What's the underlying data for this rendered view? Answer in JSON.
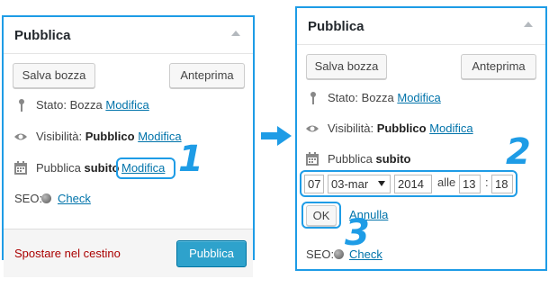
{
  "left_panel": {
    "title": "Pubblica",
    "save_draft": "Salva bozza",
    "preview": "Anteprima",
    "status_label": "Stato:",
    "status_value": "Bozza",
    "status_edit": "Modifica",
    "visibility_label": "Visibilità:",
    "visibility_value": "Pubblico",
    "visibility_edit": "Modifica",
    "publish_label": "Pubblica",
    "publish_value": "subito",
    "publish_edit": "Modifica",
    "seo_label": "SEO:",
    "seo_check": "Check",
    "trash": "Spostare nel cestino",
    "publish_button": "Pubblica"
  },
  "right_panel": {
    "title": "Pubblica",
    "save_draft": "Salva bozza",
    "preview": "Anteprima",
    "status_label": "Stato:",
    "status_value": "Bozza",
    "status_edit": "Modifica",
    "visibility_label": "Visibilità:",
    "visibility_value": "Pubblico",
    "visibility_edit": "Modifica",
    "publish_label": "Pubblica",
    "publish_value": "subito",
    "date": {
      "day": "07",
      "month": "03-mar",
      "year": "2014",
      "at": "alle",
      "hour": "13",
      "sep": ":",
      "minute": "18"
    },
    "ok": "OK",
    "cancel": "Annulla",
    "seo_label": "SEO:",
    "seo_check": "Check"
  },
  "steps": [
    "1",
    "2",
    "3"
  ],
  "colors": {
    "accent": "#1e9ce6",
    "link": "#0073aa",
    "trash": "#aa0000",
    "primary": "#2ea2cc"
  }
}
